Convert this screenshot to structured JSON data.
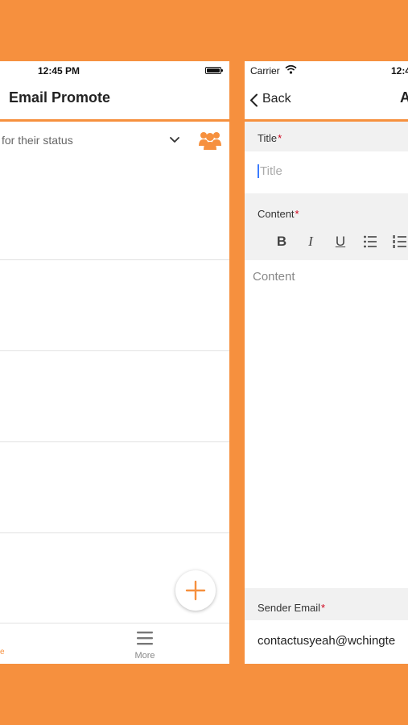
{
  "colors": {
    "brand": "#f6903e",
    "required": "#d0021b",
    "caret": "#3b7bff"
  },
  "left_screen": {
    "status_time": "12:45 PM",
    "nav_title": "Email Promote",
    "filter_text": "for their status",
    "icons": {
      "filter_dropdown": "chevron-down-icon",
      "group": "group-icon",
      "add": "plus-icon",
      "more": "menu-icon"
    },
    "list_rows": [
      "",
      "",
      "",
      "",
      ""
    ],
    "fab_label": "+",
    "tab_bar": {
      "active_partial_label": "e",
      "more_label": "More"
    }
  },
  "right_screen": {
    "carrier": "Carrier",
    "status_time": "12:4",
    "back_label": "Back",
    "nav_title": "A",
    "title_field": {
      "label": "Title",
      "placeholder": "Title",
      "value": ""
    },
    "content_field": {
      "label": "Content",
      "placeholder": "Content",
      "toolbar": {
        "bold": "B",
        "italic": "I",
        "underline": "U",
        "bullet_list": "bullet-list-icon",
        "numbered_list": "numbered-list-icon"
      }
    },
    "sender_email": {
      "label": "Sender Email",
      "value": "contactusyeah@wchingte"
    },
    "required_marker": "*"
  }
}
